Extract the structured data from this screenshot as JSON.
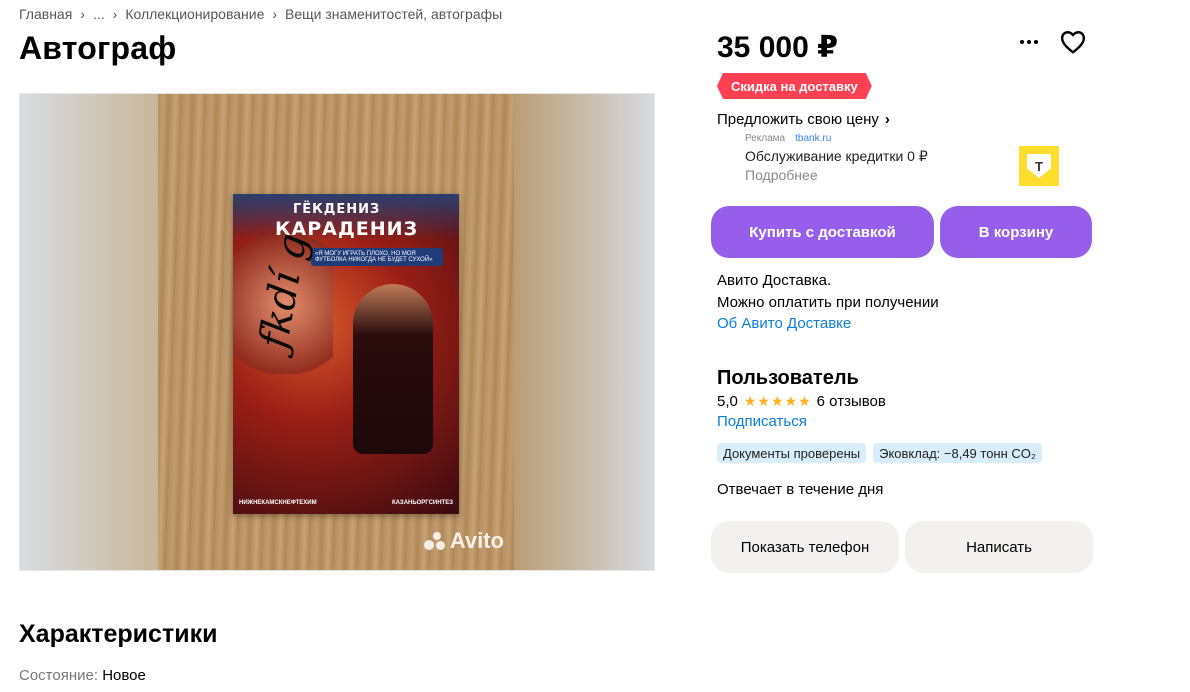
{
  "breadcrumbs": [
    "Главная",
    "...",
    "Коллекционирование",
    "Вещи знаменитостей, автографы"
  ],
  "listing": {
    "title": "Автограф",
    "price": "35 000 ₽",
    "discount_badge": "Скидка на доставку",
    "offer_price_label": "Предложить свою цену"
  },
  "photo": {
    "card_name_first": "ГЁКДЕНИЗ",
    "card_name_last": "КАРАДЕНИЗ",
    "card_quote": "«Я МОГУ ИГРАТЬ ПЛОХО, НО МОЯ ФУТБОЛКА НИКОГДА НЕ БУДЕТ СУХОЙ»",
    "card_logo_left": "НИЖНЕКАМСКНЕФТЕХИМ",
    "card_logo_right": "КАЗАНЬОРГСИНТЕЗ",
    "watermark": "Avito"
  },
  "ad": {
    "label": "Реклама",
    "domain": "tbank.ru",
    "title": "Обслуживание кредитки 0 ₽",
    "more": "Подробнее",
    "logo_letter": "Т"
  },
  "actions": {
    "buy_with_delivery": "Купить с доставкой",
    "to_cart": "В корзину",
    "show_phone": "Показать телефон",
    "write": "Написать"
  },
  "delivery": {
    "line1": "Авито Доставка.",
    "line2": "Можно оплатить при получении",
    "link": "Об Авито Доставке"
  },
  "seller": {
    "name": "Пользователь",
    "rating": "5,0",
    "stars": 5,
    "reviews": "6 отзывов",
    "subscribe": "Подписаться",
    "badges": [
      "Документы проверены",
      "Эковклад: −8,49 тонн CO₂"
    ],
    "response_time": "Отвечает в течение дня"
  },
  "specs": {
    "title": "Характеристики",
    "items": [
      {
        "label": "Состояние:",
        "value": "Новое"
      }
    ]
  },
  "colors": {
    "accent_purple": "#965eeb",
    "discount_red": "#ff4053",
    "link_blue": "#0a7ed9",
    "star_yellow": "#ffb021",
    "badge_blue": "#d9eefb"
  },
  "icons": [
    "more-icon",
    "heart-icon",
    "chevron-right-icon",
    "star-icon",
    "avito-logo-icon"
  ]
}
